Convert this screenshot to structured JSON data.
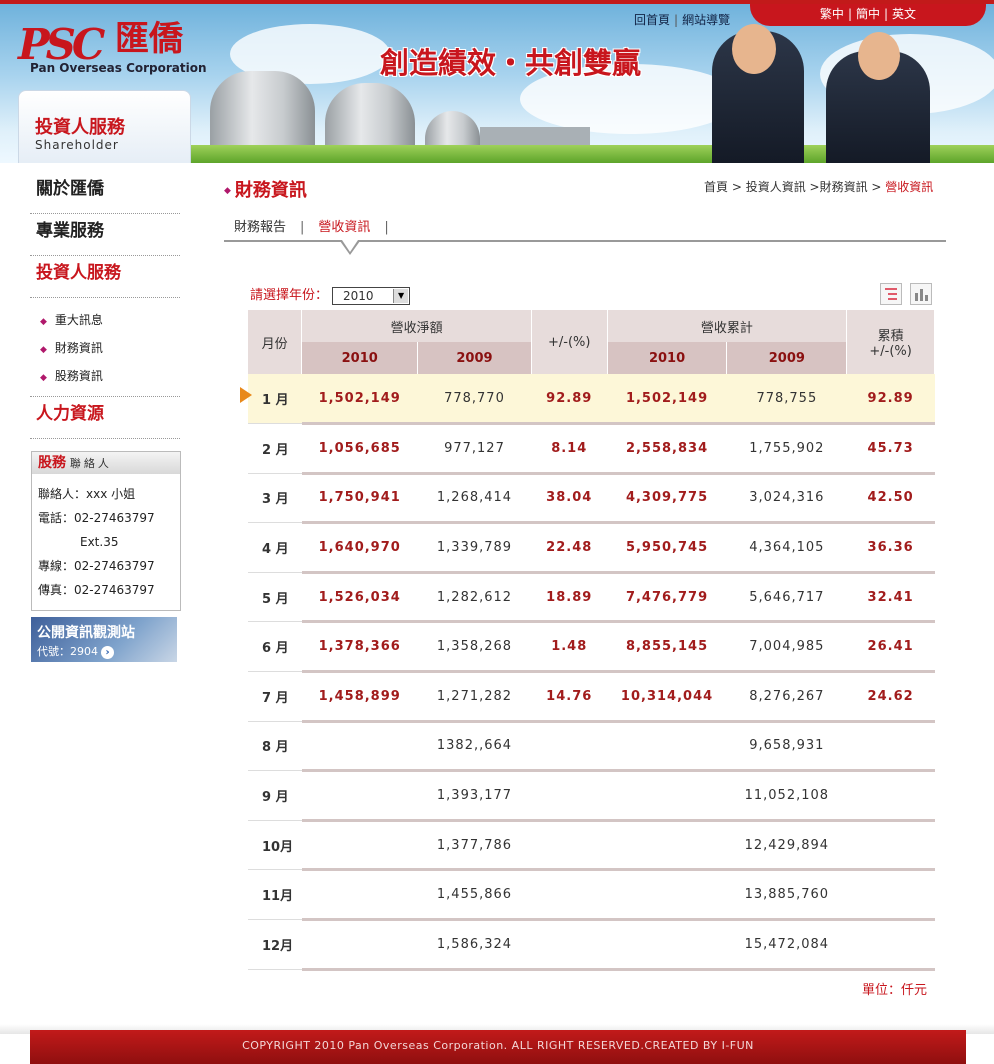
{
  "header": {
    "logo_mark": "PSC",
    "logo_cn": "匯僑",
    "logo_en": "Pan Overseas Corporation",
    "slogan": "創造績效・共創雙贏",
    "links": [
      "回首頁",
      "網站導覽"
    ],
    "languages": [
      "繁中",
      "簡中",
      "英文"
    ]
  },
  "section": {
    "title_cn": "投資人服務",
    "title_en": "Shareholder"
  },
  "sidebar": {
    "main_items": [
      "關於匯僑",
      "專業服務",
      "投資人服務"
    ],
    "sub_items": [
      "重大訊息",
      "財務資訊",
      "股務資訊"
    ],
    "last_item": "人力資源"
  },
  "contact": {
    "title_big": "股務",
    "title_small": "聯絡人",
    "person": "聯絡人：xxx 小姐",
    "phone": "電話：02-27463797",
    "ext": "Ext.35",
    "line": "專線：02-27463797",
    "fax": "傳真：02-27463797"
  },
  "banner": {
    "title": "公開資訊觀測站",
    "code": "代號：2904"
  },
  "page": {
    "title": "財務資訊",
    "breadcrumb": [
      "首頁",
      "投資人資訊",
      "財務資訊",
      "營收資訊"
    ],
    "tabs": [
      "財務報告",
      "營收資訊"
    ],
    "year_label": "請選擇年份：",
    "year_value": "2010",
    "unit": "單位：仟元"
  },
  "table": {
    "col_month": "月份",
    "col_net": "營收淨額",
    "col_pct": "+/-(%)",
    "col_cum": "營收累計",
    "col_cum_pct_1": "累積",
    "col_cum_pct_2": "+/-(%)",
    "year_a": "2010",
    "year_b": "2009",
    "rows": [
      {
        "m": "1 月",
        "a": "1,502,149",
        "b": "778,770",
        "p": "92.89",
        "ca": "1,502,149",
        "cb": "778,755",
        "cp": "92.89"
      },
      {
        "m": "2 月",
        "a": "1,056,685",
        "b": "977,127",
        "p": "8.14",
        "ca": "2,558,834",
        "cb": "1,755,902",
        "cp": "45.73"
      },
      {
        "m": "3 月",
        "a": "1,750,941",
        "b": "1,268,414",
        "p": "38.04",
        "ca": "4,309,775",
        "cb": "3,024,316",
        "cp": "42.50"
      },
      {
        "m": "4 月",
        "a": "1,640,970",
        "b": "1,339,789",
        "p": "22.48",
        "ca": "5,950,745",
        "cb": "4,364,105",
        "cp": "36.36"
      },
      {
        "m": "5 月",
        "a": "1,526,034",
        "b": "1,282,612",
        "p": "18.89",
        "ca": "7,476,779",
        "cb": "5,646,717",
        "cp": "32.41"
      },
      {
        "m": "6 月",
        "a": "1,378,366",
        "b": "1,358,268",
        "p": "1.48",
        "ca": "8,855,145",
        "cb": "7,004,985",
        "cp": "26.41"
      },
      {
        "m": "7 月",
        "a": "1,458,899",
        "b": "1,271,282",
        "p": "14.76",
        "ca": "10,314,044",
        "cb": "8,276,267",
        "cp": "24.62"
      },
      {
        "m": "8 月",
        "a": "",
        "b": "1382,,664",
        "p": "",
        "ca": "",
        "cb": "9,658,931",
        "cp": ""
      },
      {
        "m": "9 月",
        "a": "",
        "b": "1,393,177",
        "p": "",
        "ca": "",
        "cb": "11,052,108",
        "cp": ""
      },
      {
        "m": "10月",
        "a": "",
        "b": "1,377,786",
        "p": "",
        "ca": "",
        "cb": "12,429,894",
        "cp": ""
      },
      {
        "m": "11月",
        "a": "",
        "b": "1,455,866",
        "p": "",
        "ca": "",
        "cb": "13,885,760",
        "cp": ""
      },
      {
        "m": "12月",
        "a": "",
        "b": "1,586,324",
        "p": "",
        "ca": "",
        "cb": "15,472,084",
        "cp": ""
      }
    ]
  },
  "footer": {
    "copyright": "COPYRIGHT 2010 Pan Overseas Corporation. ALL RIGHT RESERVED.CREATED BY I-FUN"
  },
  "icons": [
    "list-view-icon",
    "chart-view-icon",
    "pointer-arrow-icon",
    "dropdown-arrow-icon"
  ],
  "colors": {
    "brand_red": "#c8161d",
    "highlight": "#fdf7d8",
    "header_bg": "#e7dcdb"
  }
}
